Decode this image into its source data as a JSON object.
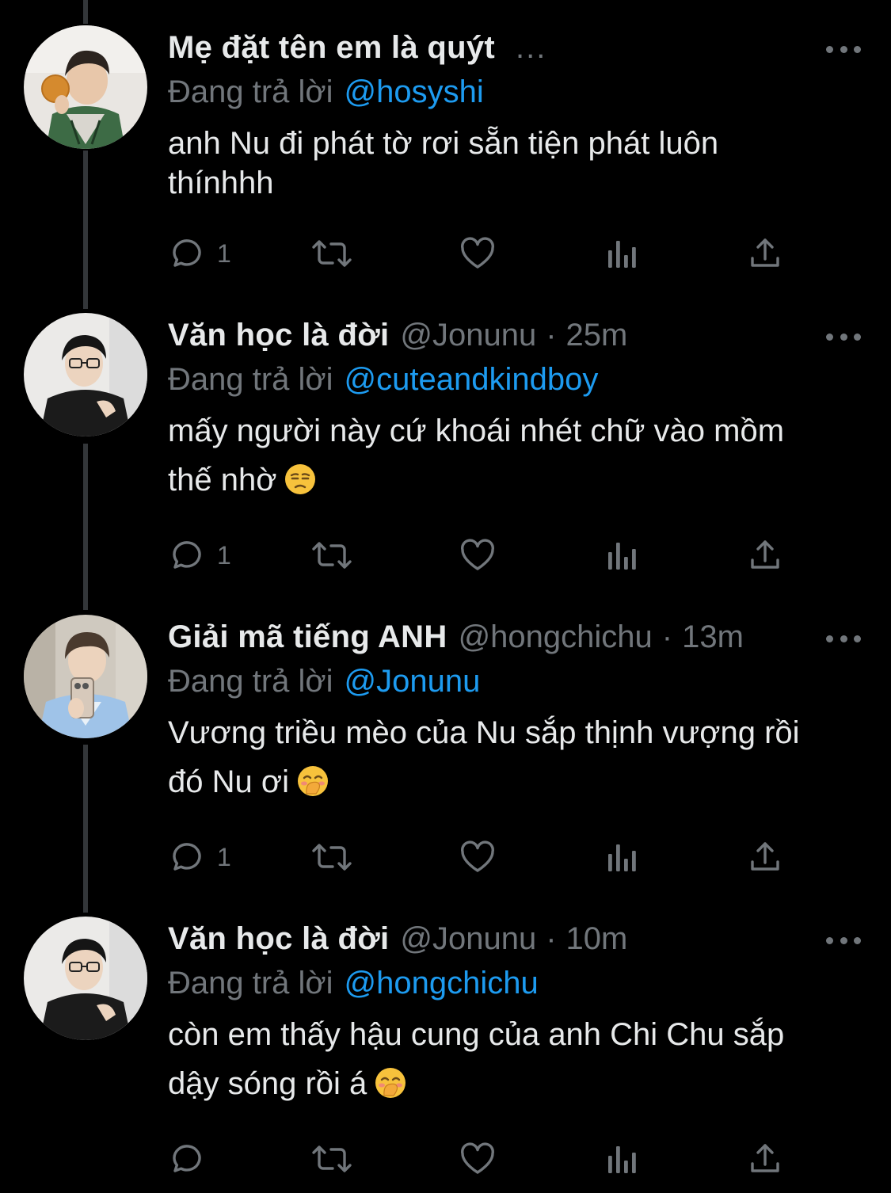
{
  "colors": {
    "background": "#000000",
    "primary_text": "#e7e9ea",
    "secondary_text": "#71767b",
    "link": "#1d9bf0",
    "thread_line": "#333639"
  },
  "tweets": [
    {
      "display_name": "Mẹ đặt tên em là quýt",
      "name_truncated": "...",
      "replying_label": "Đang trả lời",
      "replying_to": "@hosyshi",
      "lines": [
        "anh Nu đi phát tờ rơi sẵn tiện phát luôn",
        "thínhhh"
      ],
      "reply_count": "1",
      "icons": [
        "reply-icon",
        "retweet-icon",
        "like-icon",
        "views-icon",
        "share-icon"
      ]
    },
    {
      "display_name": "Văn học là đời",
      "handle": "@Jonunu",
      "dot": "·",
      "time": "25m",
      "replying_label": "Đang trả lời",
      "replying_to": "@cuteandkindboy",
      "lines": [
        "mấy người này cứ khoái nhét chữ vào mồm",
        "thế nhờ"
      ],
      "emoji": "unamused-face-emoji",
      "reply_count": "1"
    },
    {
      "display_name": "Giải mã tiếng ANH",
      "handle": "@hongchichu",
      "dot": "·",
      "time": "13m",
      "replying_label": "Đang trả lời",
      "replying_to": "@Jonunu",
      "lines": [
        "Vương triều mèo của Nu sắp thịnh vượng rồi",
        "đó Nu ơi"
      ],
      "emoji": "hand-over-mouth-emoji",
      "reply_count": "1"
    },
    {
      "display_name": "Văn học là đời",
      "handle": "@Jonunu",
      "dot": "·",
      "time": "10m",
      "replying_label": "Đang trả lời",
      "replying_to": "@hongchichu",
      "lines": [
        "còn em thấy hậu cung của anh Chi Chu sắp",
        "dậy sóng rồi á"
      ],
      "emoji": "hand-over-mouth-emoji",
      "reply_count": ""
    }
  ]
}
